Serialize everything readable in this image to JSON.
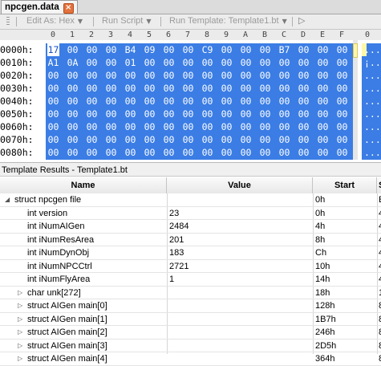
{
  "file_tab": {
    "name": "npcgen.data",
    "close": "×"
  },
  "toolbar": {
    "edit_as": "Edit As: Hex",
    "run_script": "Run Script",
    "run_template": "Run Template: Template1.bt",
    "run_icon": "▷",
    "dropdown_icon": "▼"
  },
  "hex": {
    "columns": [
      "0",
      "1",
      "2",
      "3",
      "4",
      "5",
      "6",
      "7",
      "8",
      "9",
      "A",
      "B",
      "C",
      "D",
      "E",
      "F"
    ],
    "rows": [
      {
        "addr": "0000h:",
        "bytes": [
          "17",
          "00",
          "00",
          "00",
          "B4",
          "09",
          "00",
          "00",
          "C9",
          "00",
          "00",
          "00",
          "B7",
          "00",
          "00",
          "00"
        ],
        "ascii": "...."
      },
      {
        "addr": "0010h:",
        "bytes": [
          "A1",
          "0A",
          "00",
          "00",
          "01",
          "00",
          "00",
          "00",
          "00",
          "00",
          "00",
          "00",
          "00",
          "00",
          "00",
          "00"
        ],
        "ascii": "¡..."
      },
      {
        "addr": "0020h:",
        "bytes": [
          "00",
          "00",
          "00",
          "00",
          "00",
          "00",
          "00",
          "00",
          "00",
          "00",
          "00",
          "00",
          "00",
          "00",
          "00",
          "00"
        ],
        "ascii": "...."
      },
      {
        "addr": "0030h:",
        "bytes": [
          "00",
          "00",
          "00",
          "00",
          "00",
          "00",
          "00",
          "00",
          "00",
          "00",
          "00",
          "00",
          "00",
          "00",
          "00",
          "00"
        ],
        "ascii": "...."
      },
      {
        "addr": "0040h:",
        "bytes": [
          "00",
          "00",
          "00",
          "00",
          "00",
          "00",
          "00",
          "00",
          "00",
          "00",
          "00",
          "00",
          "00",
          "00",
          "00",
          "00"
        ],
        "ascii": "...."
      },
      {
        "addr": "0050h:",
        "bytes": [
          "00",
          "00",
          "00",
          "00",
          "00",
          "00",
          "00",
          "00",
          "00",
          "00",
          "00",
          "00",
          "00",
          "00",
          "00",
          "00"
        ],
        "ascii": "...."
      },
      {
        "addr": "0060h:",
        "bytes": [
          "00",
          "00",
          "00",
          "00",
          "00",
          "00",
          "00",
          "00",
          "00",
          "00",
          "00",
          "00",
          "00",
          "00",
          "00",
          "00"
        ],
        "ascii": "...."
      },
      {
        "addr": "0070h:",
        "bytes": [
          "00",
          "00",
          "00",
          "00",
          "00",
          "00",
          "00",
          "00",
          "00",
          "00",
          "00",
          "00",
          "00",
          "00",
          "00",
          "00"
        ],
        "ascii": "...."
      },
      {
        "addr": "0080h:",
        "bytes": [
          "00",
          "00",
          "00",
          "00",
          "00",
          "00",
          "00",
          "00",
          "00",
          "00",
          "00",
          "00",
          "00",
          "00",
          "00",
          "00"
        ],
        "ascii": "...."
      }
    ]
  },
  "template_panel": {
    "title": "Template Results - Template1.bt",
    "headers": {
      "name": "Name",
      "value": "Value",
      "start": "Start",
      "size": "S"
    },
    "rows": [
      {
        "name": "struct npcgen file",
        "value": "",
        "start": "0h",
        "size": "E",
        "indent": 0,
        "expander": "◢"
      },
      {
        "name": "int version",
        "value": "23",
        "start": "0h",
        "size": "4",
        "indent": 1,
        "expander": ""
      },
      {
        "name": "int iNumAIGen",
        "value": "2484",
        "start": "4h",
        "size": "4",
        "indent": 1,
        "expander": ""
      },
      {
        "name": "int iNumResArea",
        "value": "201",
        "start": "8h",
        "size": "4",
        "indent": 1,
        "expander": ""
      },
      {
        "name": "int iNumDynObj",
        "value": "183",
        "start": "Ch",
        "size": "4",
        "indent": 1,
        "expander": ""
      },
      {
        "name": "int iNumNPCCtrl",
        "value": "2721",
        "start": "10h",
        "size": "4",
        "indent": 1,
        "expander": ""
      },
      {
        "name": "int iNumFlyArea",
        "value": "1",
        "start": "14h",
        "size": "4",
        "indent": 1,
        "expander": ""
      },
      {
        "name": "char unk[272]",
        "value": "",
        "start": "18h",
        "size": "1",
        "indent": 1,
        "expander": "▷"
      },
      {
        "name": "struct AIGen main[0]",
        "value": "",
        "start": "128h",
        "size": "8",
        "indent": 1,
        "expander": "▷"
      },
      {
        "name": "struct AIGen main[1]",
        "value": "",
        "start": "1B7h",
        "size": "8",
        "indent": 1,
        "expander": "▷"
      },
      {
        "name": "struct AIGen main[2]",
        "value": "",
        "start": "246h",
        "size": "8",
        "indent": 1,
        "expander": "▷"
      },
      {
        "name": "struct AIGen main[3]",
        "value": "",
        "start": "2D5h",
        "size": "8",
        "indent": 1,
        "expander": "▷"
      },
      {
        "name": "struct AIGen main[4]",
        "value": "",
        "start": "364h",
        "size": "8",
        "indent": 1,
        "expander": "▷"
      }
    ]
  },
  "colors": {
    "selection": "#3b7de5",
    "first_byte_text": "#1a4fc0",
    "scroll_thumb": "#fff6a8",
    "close_button": "#e5713b"
  }
}
